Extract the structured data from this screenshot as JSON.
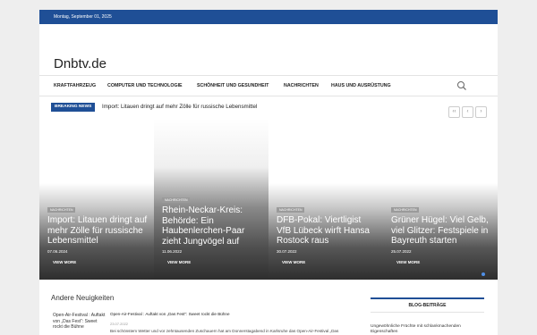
{
  "topbar": {
    "date": "Montag, September 01, 2025"
  },
  "site": {
    "title": "Dnbtv.de"
  },
  "nav": {
    "items": [
      "KRAFTFAHRZEUG",
      "COMPUTER UND TECHNOLOGIE",
      "SCHÖNHEIT UND GESUNDHEIT",
      "NACHRICHTEN",
      "HAUS UND AUSRÜSTUNG"
    ],
    "search_icon": "search-icon"
  },
  "breaking": {
    "label": "BREAKING NEWS",
    "headline": "Import: Litauen dringt auf mehr Zölle für russische Lebensmittel",
    "controls": [
      "‹‹",
      "‹",
      "›"
    ]
  },
  "slides": [
    {
      "category": "NACHRICHTEN",
      "title": "Import: Litauen dringt auf mehr Zölle für russische Lebensmittel",
      "date": "07.06.2024",
      "more": "VIEW MORE"
    },
    {
      "category": "NACHRICHTEN",
      "title": "Rhein-Neckar-Kreis: Behörde: Ein Haubenlerchen-Paar zieht Jungvögel auf",
      "date": "11.06.2022",
      "more": "VIEW MORE"
    },
    {
      "category": "NACHRICHTEN",
      "title": "DFB-Pokal: Viertligist VfB Lübeck wirft Hansa Rostock raus",
      "date": "30.07.2022",
      "more": "VIEW MORE"
    },
    {
      "category": "NACHRICHTEN",
      "title": "Grüner Hügel: Viel Gelb, viel Glitzer: Festspiele in Bayreuth starten",
      "date": "25.07.2022",
      "more": "VIEW MORE"
    }
  ],
  "andere": {
    "heading": "Andere Neuigkeiten",
    "thumb_alt": "Open-Air-Festival : Auftakt von „Das Fest“: Sweet rockt die Bühne",
    "post_title": "Open-Air-Festival : Auftakt von „Das Fest“: Sweet rockt die Bühne",
    "post_date": "23.07.2022",
    "post_excerpt": "Bei schönstem Wetter und vor zehntausenden Zuschauern hat am Donnerstagabend in Karlsruhe das Open-Air-Festival „Das"
  },
  "sidebar": {
    "title": "BLOG-BEITRÄGE",
    "first_item": "Ungewöhnliche Früchte mit schlankmachenden Eigenschaften"
  },
  "colors": {
    "accent": "#1f4f96",
    "slider_dot": "#4f8fe6"
  }
}
